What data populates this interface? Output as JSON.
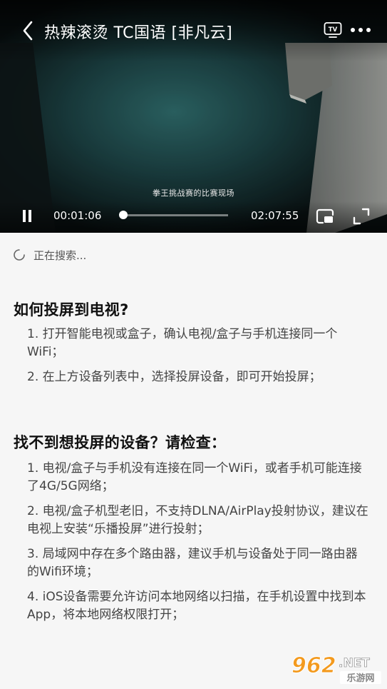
{
  "player": {
    "title": "热辣滚烫 TC国语 [非凡云]",
    "subtitle": "拳王挑战赛的比赛现场",
    "current_time": "00:01:06",
    "total_time": "02:07:55",
    "progress_fraction": 0.0086,
    "icons": [
      "back-arrow-icon",
      "tv-cast-icon",
      "more-icon",
      "pause-icon",
      "picture-in-picture-icon",
      "fullscreen-icon"
    ],
    "tv_label": "TV"
  },
  "search_status": "正在搜索...",
  "sections": [
    {
      "heading": "如何投屏到电视?",
      "steps": [
        "1. 打开智能电视或盒子，确认电视/盒子与手机连接同一个WiFi；",
        "2. 在上方设备列表中，选择投屏设备，即可开始投屏；"
      ]
    },
    {
      "heading": "找不到想投屏的设备？请检查：",
      "steps": [
        "1. 电视/盒子与手机没有连接在同一个WiFi，或者手机可能连接了4G/5G网络；",
        "2. 电视/盒子机型老旧，不支持DLNA/AirPlay投射协议，建议在电视上安装“乐播投屏”进行投射；",
        "3. 局域网中存在多个路由器，建议手机与设备处于同一路由器的Wifi环境；",
        "4. iOS设备需要允许访问本地网络以扫描，在手机设置中找到本App，将本地网络权限打开；"
      ]
    }
  ],
  "watermark": {
    "brand": "962",
    "suffix": ".NET",
    "site_name": "乐游网"
  },
  "colors": {
    "background": "#f6f6f6",
    "player_bg": "#0d1416",
    "watermark_orange": "#f39a1e"
  }
}
